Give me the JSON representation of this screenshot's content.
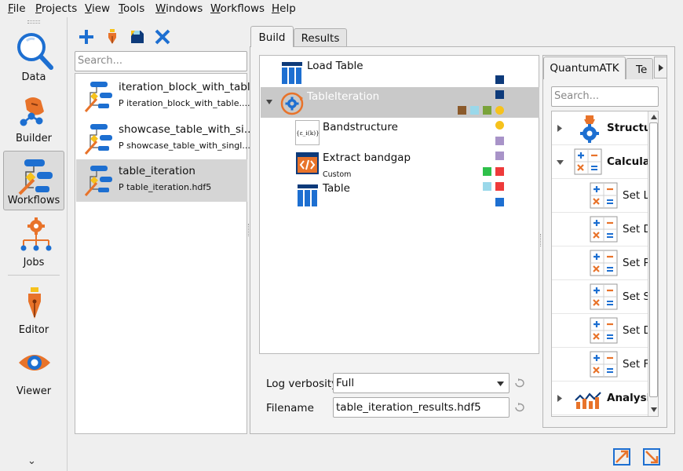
{
  "menubar": {
    "items": [
      {
        "first": "F",
        "rest": "ile"
      },
      {
        "first": "P",
        "rest": "rojects"
      },
      {
        "first": "V",
        "rest": "iew"
      },
      {
        "first": "T",
        "rest": "ools"
      },
      {
        "first": "W",
        "rest": "indows"
      },
      {
        "first": "W",
        "rest": "orkflows"
      },
      {
        "first": "H",
        "rest": "elp"
      }
    ]
  },
  "rail": {
    "items": [
      {
        "label": "Data",
        "icon": "magnifier-icon"
      },
      {
        "label": "Builder",
        "icon": "builder-hand-icon"
      },
      {
        "label": "Workflows",
        "icon": "workflows-icon"
      },
      {
        "label": "Jobs",
        "icon": "jobs-gear-icon"
      },
      {
        "label": "Editor",
        "icon": "pen-nib-icon"
      },
      {
        "label": "Viewer",
        "icon": "eye-icon"
      }
    ],
    "more_glyph": "⌄"
  },
  "toolbar": {
    "icons": [
      "add-icon",
      "edit-pen-icon",
      "save-icon",
      "delete-icon"
    ]
  },
  "left_search": {
    "placeholder": "Search..."
  },
  "workflows": [
    {
      "title": "iteration_block_with_table",
      "subtitle": "P iteration_block_with_table...."
    },
    {
      "title": "showcase_table_with_si...",
      "subtitle": "P showcase_table_with_singl..."
    },
    {
      "title": "table_iteration",
      "subtitle": "P table_iteration.hdf5"
    }
  ],
  "tabs": {
    "build": "Build",
    "results": "Results"
  },
  "tree": [
    {
      "name": "Load Table",
      "sub": ""
    },
    {
      "name": "TableIteration",
      "sub": ""
    },
    {
      "name": "Bandstructure",
      "sub": "",
      "formula": "{ε_i(k)}"
    },
    {
      "name": "Extract bandgap",
      "sub": "Custom"
    },
    {
      "name": "Table",
      "sub": ""
    }
  ],
  "fields": {
    "log_label": "Log verbosity",
    "log_value": "Full",
    "file_label": "Filename",
    "file_value": "table_iteration_results.hdf5"
  },
  "palette": {
    "tab_active": "QuantumATK",
    "tab_next": "Te",
    "search_placeholder": "Search...",
    "rows": [
      {
        "label": "Structur",
        "bold": true
      },
      {
        "label": "Calculat",
        "bold": true
      },
      {
        "label": "Set L",
        "bold": false
      },
      {
        "label": "Set D",
        "bold": false
      },
      {
        "label": "Set P",
        "bold": false
      },
      {
        "label": "Set S",
        "bold": false
      },
      {
        "label": "Set D",
        "bold": false
      },
      {
        "label": "Set F",
        "bold": false
      },
      {
        "label": "Analysis",
        "bold": true
      }
    ]
  },
  "colors": {
    "accent_blue": "#1d6fd1",
    "navy": "#0d3a7a",
    "orange": "#e8732a",
    "yellow": "#f6c21c",
    "lavender": "#a893c8",
    "brown": "#8b5a2b",
    "light_blue": "#9ad8ea",
    "olive": "#7aa33a",
    "green": "#2ec04a",
    "red": "#ee3a3a"
  }
}
